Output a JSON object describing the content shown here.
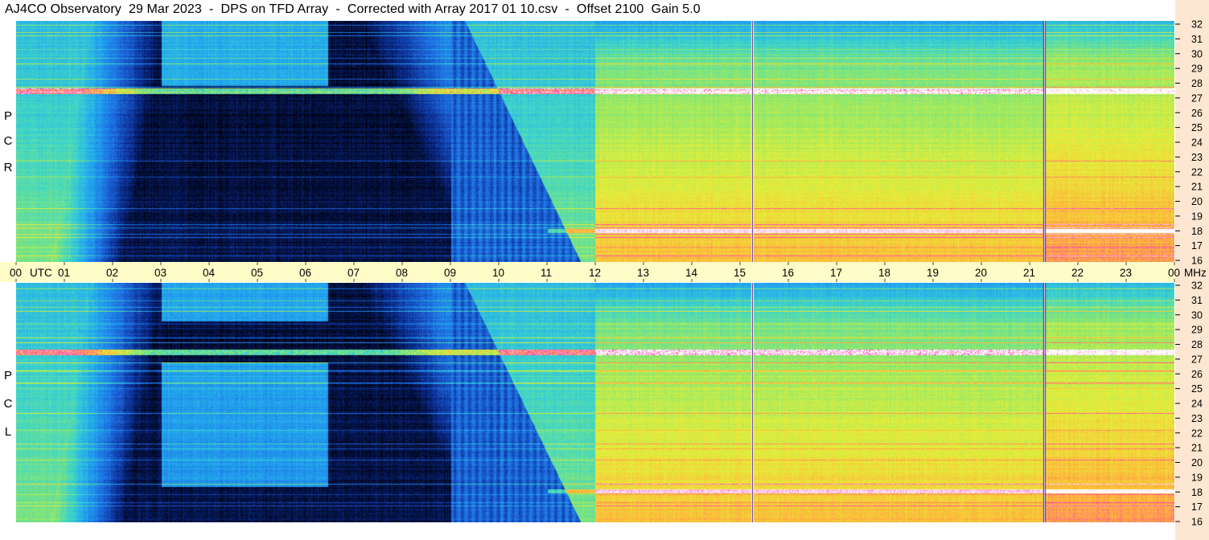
{
  "title": "AJ4CO Observatory  29 Mar 2023  -  DPS on TFD Array  -  Corrected with Array 2017 01 10.csv  -  Offset 2100  Gain 5.0",
  "panels": [
    {
      "id": "rcp",
      "label_letters": [
        "P",
        "C",
        "R"
      ]
    },
    {
      "id": "lcp",
      "label_letters": [
        "P",
        "C",
        "L"
      ]
    }
  ],
  "colors": {
    "background": "#041a66",
    "utc_band": "#fffcc8",
    "freq_strip": "#fde7d2",
    "colormap": [
      "#00000a",
      "#0a2a8c",
      "#1e6be0",
      "#22a8f0",
      "#3fd6c8",
      "#8fe86a",
      "#e6ef3a",
      "#ffb43a",
      "#ff3fae",
      "#ffffff"
    ]
  },
  "chart_data": {
    "type": "heatmap",
    "title": "AJ4CO Observatory  29 Mar 2023  -  DPS on TFD Array  -  Corrected with Array 2017 01 10.csv  -  Offset 2100  Gain 5.0",
    "xlabel": "UTC",
    "ylabel": "MHz",
    "x_ticks": [
      "00",
      "01",
      "02",
      "03",
      "04",
      "05",
      "06",
      "07",
      "08",
      "09",
      "10",
      "11",
      "12",
      "13",
      "14",
      "15",
      "16",
      "17",
      "18",
      "19",
      "20",
      "21",
      "22",
      "23",
      "00"
    ],
    "x_unit_label": "UTC",
    "x_end_unit_label": "MHz",
    "y_ticks": [
      "32",
      "31",
      "30",
      "29",
      "28",
      "27",
      "26",
      "25",
      "24",
      "23",
      "22",
      "21",
      "20",
      "19",
      "18",
      "17",
      "16"
    ],
    "y_range": [
      16,
      32
    ],
    "x_range_hours": [
      0,
      24
    ],
    "grid": false,
    "description": "Dynamic spectra (frequency vs UTC) for RCP and LCP polarizations; intensity shown by color.",
    "series": [
      {
        "name": "RCP"
      },
      {
        "name": "LCP"
      }
    ]
  }
}
